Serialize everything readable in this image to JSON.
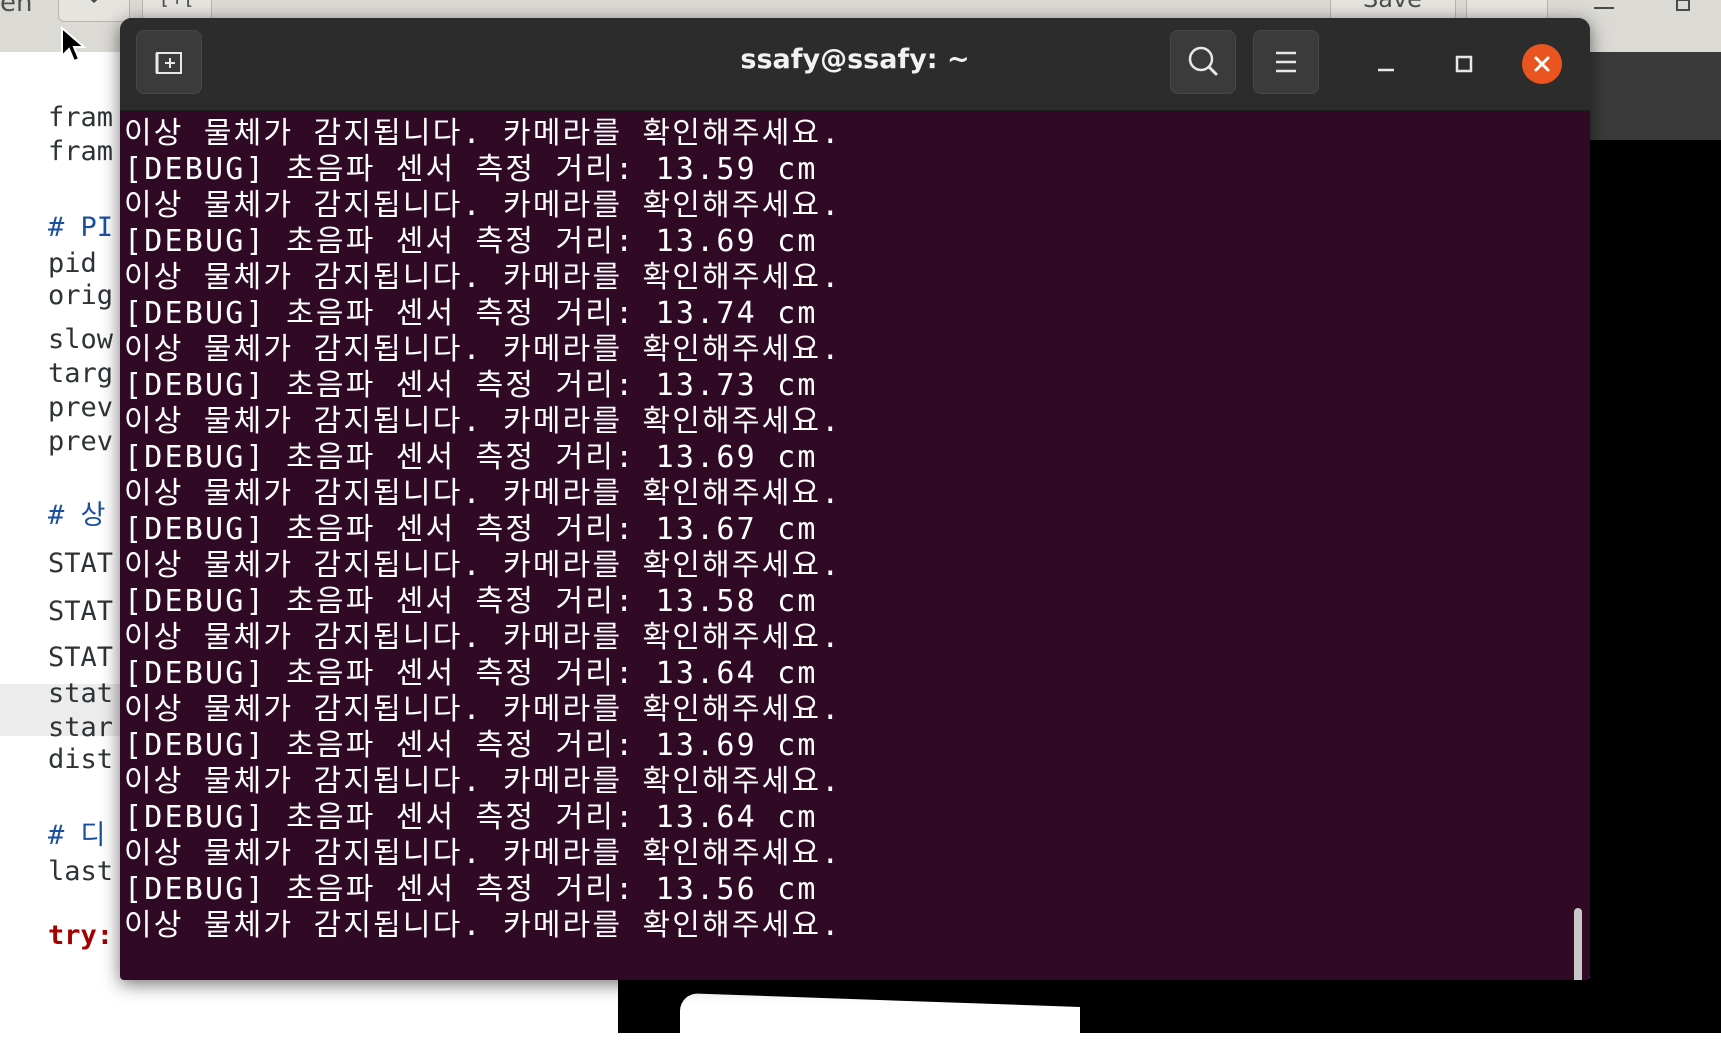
{
  "background_editor": {
    "header_fragments": [
      "en",
      "[+[",
      "Save"
    ],
    "code_lines": [
      {
        "text": "fram",
        "style": "normal"
      },
      {
        "text": "fram",
        "style": "normal"
      },
      {
        "text": "# PI",
        "style": "comment"
      },
      {
        "text": "pid ",
        "style": "normal"
      },
      {
        "text": "orig",
        "style": "normal"
      },
      {
        "text": "slow",
        "style": "normal"
      },
      {
        "text": "targ",
        "style": "normal"
      },
      {
        "text": "prev",
        "style": "normal"
      },
      {
        "text": "prev",
        "style": "normal"
      },
      {
        "text": "# 상",
        "style": "comment"
      },
      {
        "text": "STAT",
        "style": "normal"
      },
      {
        "text": "STAT",
        "style": "normal"
      },
      {
        "text": "STAT",
        "style": "normal"
      },
      {
        "text": "stat",
        "style": "normal"
      },
      {
        "text": "star",
        "style": "normal"
      },
      {
        "text": "dist",
        "style": "normal"
      },
      {
        "text": "# 디",
        "style": "comment"
      },
      {
        "text": "last",
        "style": "normal"
      },
      {
        "text": "try:",
        "style": "keyword"
      }
    ]
  },
  "terminal": {
    "title": "ssafy@ssafy: ~",
    "colors": {
      "background": "#300a24",
      "titlebar": "#2c2c2c",
      "close": "#e95420"
    },
    "lines": [
      "이상 물체가 감지됩니다. 카메라를 확인해주세요.",
      "[DEBUG] 초음파 센서 측정 거리: 13.59 cm",
      "이상 물체가 감지됩니다. 카메라를 확인해주세요.",
      "[DEBUG] 초음파 센서 측정 거리: 13.69 cm",
      "이상 물체가 감지됩니다. 카메라를 확인해주세요.",
      "[DEBUG] 초음파 센서 측정 거리: 13.74 cm",
      "이상 물체가 감지됩니다. 카메라를 확인해주세요.",
      "[DEBUG] 초음파 센서 측정 거리: 13.73 cm",
      "이상 물체가 감지됩니다. 카메라를 확인해주세요.",
      "[DEBUG] 초음파 센서 측정 거리: 13.69 cm",
      "이상 물체가 감지됩니다. 카메라를 확인해주세요.",
      "[DEBUG] 초음파 센서 측정 거리: 13.67 cm",
      "이상 물체가 감지됩니다. 카메라를 확인해주세요.",
      "[DEBUG] 초음파 센서 측정 거리: 13.58 cm",
      "이상 물체가 감지됩니다. 카메라를 확인해주세요.",
      "[DEBUG] 초음파 센서 측정 거리: 13.64 cm",
      "이상 물체가 감지됩니다. 카메라를 확인해주세요.",
      "[DEBUG] 초음파 센서 측정 거리: 13.69 cm",
      "이상 물체가 감지됩니다. 카메라를 확인해주세요.",
      "[DEBUG] 초음파 센서 측정 거리: 13.64 cm",
      "이상 물체가 감지됩니다. 카메라를 확인해주세요.",
      "[DEBUG] 초음파 센서 측정 거리: 13.56 cm",
      "이상 물체가 감지됩니다. 카메라를 확인해주세요."
    ],
    "icons": {
      "new_tab": "new-tab-icon",
      "search": "search-icon",
      "menu": "hamburger-menu-icon",
      "minimize": "minimize-icon",
      "maximize": "maximize-icon",
      "close": "close-icon"
    }
  }
}
